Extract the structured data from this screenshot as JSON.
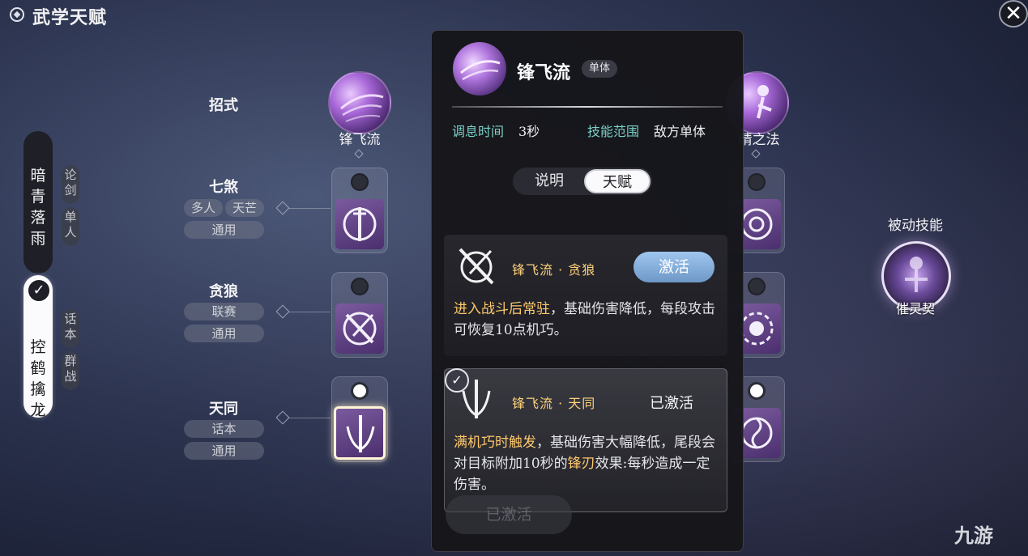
{
  "header": {
    "title": "武学天赋"
  },
  "schools": [
    {
      "name": "暗青落雨",
      "tags": [
        "论剑",
        "单人"
      ],
      "selected": false
    },
    {
      "name": "控鹤擒龙",
      "tags": [
        "话本",
        "群战"
      ],
      "selected": true
    }
  ],
  "rows": {
    "zhaoshi": {
      "label": "招式"
    },
    "qisha": {
      "label": "七煞",
      "tags": [
        "多人",
        "天芒",
        "通用"
      ]
    },
    "tanlang": {
      "label": "贪狼",
      "tags": [
        "联赛",
        "通用"
      ]
    },
    "tiantong": {
      "label": "天同",
      "tags": [
        "话本",
        "通用"
      ]
    }
  },
  "columns": {
    "left": {
      "name": "锋飞流"
    },
    "right": {
      "name": "晴之法"
    }
  },
  "popup": {
    "title": "锋飞流",
    "badge": "单体",
    "cooldown_label": "调息时间",
    "cooldown_value": "3秒",
    "range_label": "技能范围",
    "range_value": "敌方单体",
    "tabs": [
      "说明",
      "天赋"
    ],
    "active_tab": "天赋",
    "talents": [
      {
        "name": "锋飞流 · 贪狼",
        "button": "激活",
        "desc_highlight": "进入战斗后常驻",
        "desc_rest": "，基础伤害降低，每段攻击可恢复10点机巧。"
      },
      {
        "name": "锋飞流 · 天同",
        "status": "已激活",
        "desc_highlight": "满机巧时触发",
        "desc_mid": "，基础伤害大幅降低，尾段会对目标附加10秒的",
        "desc_highlight2": "锋刃",
        "desc_end": "效果:每秒造成一定伤害。"
      }
    ],
    "bottom_button": "已激活"
  },
  "passive": {
    "title": "被动技能",
    "name": "催灵契"
  },
  "watermark": "九游",
  "colors": {
    "accent_gold": "#ffc86a",
    "label_teal": "#7ad0c8",
    "activate_blue": "#8ab4e0"
  },
  "icons": [
    "settings-icon",
    "close-icon",
    "check-icon",
    "sword-emblem-icon",
    "crossed-blade-icon",
    "taiji-icon",
    "talisman-icon"
  ]
}
